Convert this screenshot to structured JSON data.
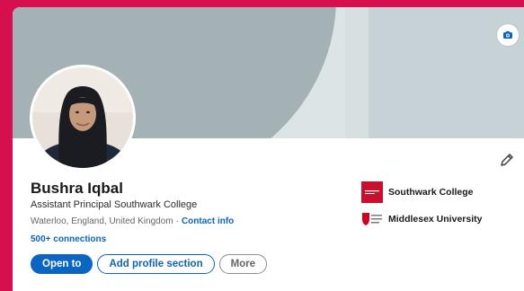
{
  "profile": {
    "name": "Bushra Iqbal",
    "headline": "Assistant Principal Southwark College",
    "location": "Waterloo, England, United Kingdom",
    "separator": "·",
    "contact_info_label": "Contact info",
    "connections": "500+ connections"
  },
  "actions": {
    "open_to": "Open to",
    "add_section": "Add profile section",
    "more": "More"
  },
  "organizations": [
    {
      "name": "Southwark College",
      "logo": "southwark-college-logo"
    },
    {
      "name": "Middlesex University",
      "logo": "middlesex-university-logo"
    }
  ],
  "colors": {
    "accent": "#0a66c2",
    "page_background": "#d6104f",
    "banner_shape": "#a4b2b6"
  },
  "icons": {
    "banner_edit": "camera-icon",
    "intro_edit": "pencil-icon"
  }
}
